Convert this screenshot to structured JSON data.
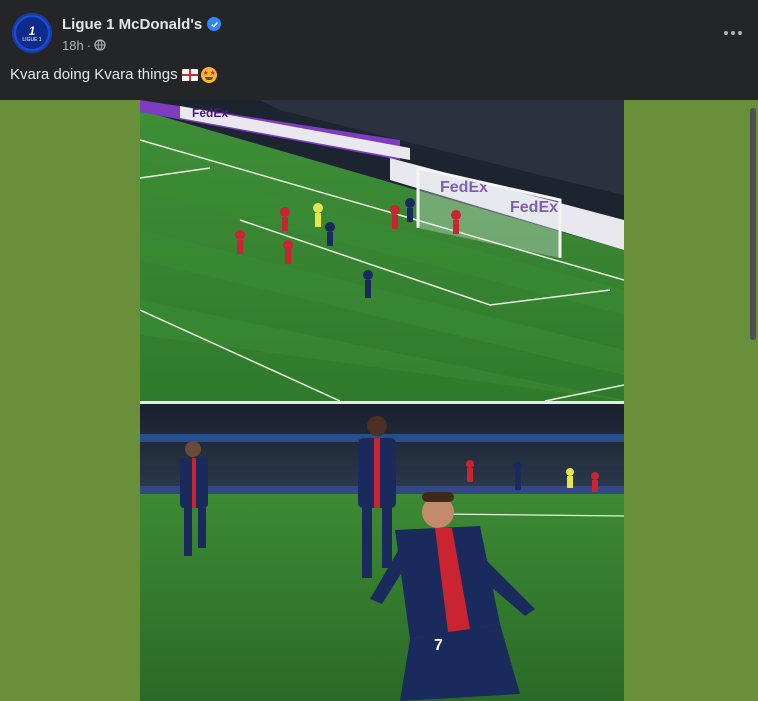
{
  "post": {
    "page_name": "Ligue 1 McDonald's",
    "avatar_logo_number": "1",
    "avatar_logo_text": "LIGUE 1",
    "timestamp": "18h",
    "separator": "·",
    "visibility_icon": "globe-icon",
    "verified_icon": "verified-badge-icon",
    "more_icon": "more-options-icon",
    "caption": "Kvara doing Kvara things",
    "caption_emojis": [
      "england-flag",
      "star-struck"
    ]
  },
  "media": {
    "images": [
      {
        "name": "penalty-box-goal-scene",
        "ads": [
          "FedEx",
          "FedEx",
          "FedEx",
          "FedEx"
        ]
      },
      {
        "name": "goal-celebration-scene",
        "player_number": "7"
      }
    ]
  },
  "colors": {
    "background": "#242526",
    "text_primary": "#e4e6eb",
    "text_secondary": "#b0b3b8",
    "verified": "#2d88ff",
    "media_backdrop": "#6a8f3a"
  }
}
